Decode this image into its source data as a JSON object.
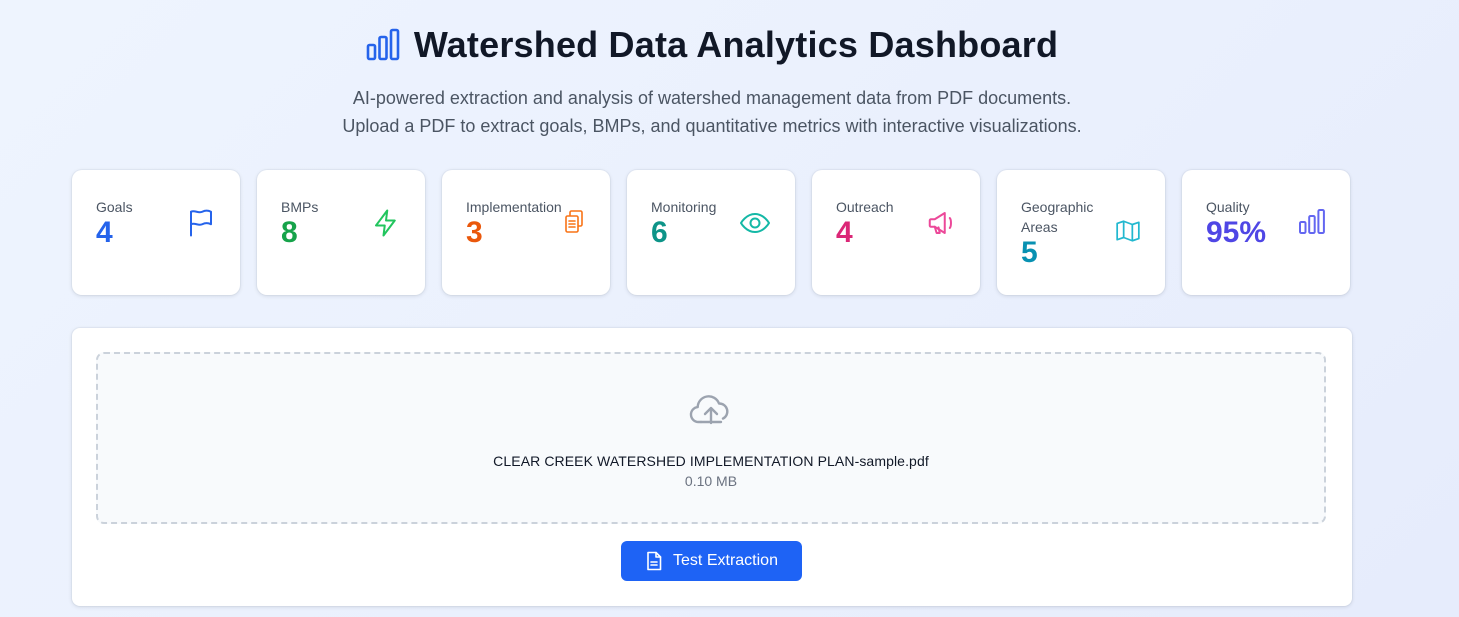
{
  "header": {
    "title": "Watershed Data Analytics Dashboard",
    "title_icon": "bar-chart-icon",
    "subtitle_line1": "AI-powered extraction and analysis of watershed management data from PDF documents.",
    "subtitle_line2": "Upload a PDF to extract goals, BMPs, and quantitative metrics with interactive visualizations."
  },
  "stats": [
    {
      "label": "Goals",
      "value": "4",
      "icon": "flag-icon",
      "color": "#2563eb"
    },
    {
      "label": "BMPs",
      "value": "8",
      "icon": "lightning-icon",
      "color": "#16a34a"
    },
    {
      "label": "Implementation",
      "value": "3",
      "icon": "clipboard-icon",
      "color": "#ea580c"
    },
    {
      "label": "Monitoring",
      "value": "6",
      "icon": "eye-icon",
      "color": "#0d9488"
    },
    {
      "label": "Outreach",
      "value": "4",
      "icon": "megaphone-icon",
      "color": "#db2777"
    },
    {
      "label": "Geographic Areas",
      "value": "5",
      "icon": "map-icon",
      "color": "#0891b2"
    },
    {
      "label": "Quality",
      "value": "95%",
      "icon": "bar-chart-icon",
      "color": "#4f46e5"
    }
  ],
  "upload": {
    "icon": "cloud-upload-icon",
    "filename": "CLEAR CREEK WATERSHED IMPLEMENTATION PLAN-sample.pdf",
    "filesize": "0.10 MB",
    "button_label": "Test Extraction",
    "button_icon": "document-icon",
    "button_color": "#1e63f5"
  }
}
